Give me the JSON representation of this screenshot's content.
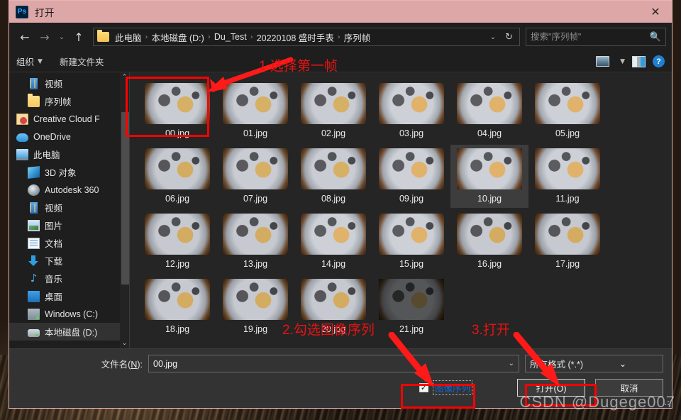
{
  "window": {
    "title": "打开",
    "app_icon": "photoshop-icon",
    "close_label": "✕",
    "titlebar_color": "#dea7a7"
  },
  "nav": {
    "back": "←",
    "forward": "→",
    "recent": "⌄",
    "up": "↑",
    "breadcrumbs": [
      "此电脑",
      "本地磁盘 (D:)",
      "Du_Test",
      "20220108 盛时手表",
      "序列帧"
    ],
    "separator": "›",
    "dropdown_caret": "⌄",
    "refresh": "↻",
    "search_placeholder": "搜索\"序列帧\"",
    "search_value": "",
    "search_icon": "search-icon"
  },
  "command_bar": {
    "organize": "组织",
    "organize_caret": "▼",
    "new_folder": "新建文件夹",
    "view_caret": "▼",
    "icons": [
      "view-mode-icon",
      "preview-pane-icon",
      "help-icon"
    ],
    "help_glyph": "?"
  },
  "sidebar": {
    "items": [
      {
        "label": "视频",
        "icon": "video-icon",
        "indent": true,
        "selected": false
      },
      {
        "label": "序列帧",
        "icon": "folder-icon",
        "indent": true,
        "selected": false
      },
      {
        "label": "Creative Cloud F",
        "icon": "creative-cloud-icon",
        "indent": false,
        "selected": false
      },
      {
        "label": "OneDrive",
        "icon": "onedrive-icon",
        "indent": false,
        "selected": false
      },
      {
        "label": "此电脑",
        "icon": "this-pc-icon",
        "indent": false,
        "selected": false
      },
      {
        "label": "3D 对象",
        "icon": "3d-objects-icon",
        "indent": true,
        "selected": false
      },
      {
        "label": "Autodesk 360",
        "icon": "autodesk-icon",
        "indent": true,
        "selected": false
      },
      {
        "label": "视频",
        "icon": "video-icon",
        "indent": true,
        "selected": false
      },
      {
        "label": "图片",
        "icon": "pictures-icon",
        "indent": true,
        "selected": false
      },
      {
        "label": "文档",
        "icon": "documents-icon",
        "indent": true,
        "selected": false
      },
      {
        "label": "下载",
        "icon": "downloads-icon",
        "indent": true,
        "selected": false
      },
      {
        "label": "音乐",
        "icon": "music-icon",
        "indent": true,
        "selected": false
      },
      {
        "label": "桌面",
        "icon": "desktop-icon",
        "indent": true,
        "selected": false
      },
      {
        "label": "Windows (C:)",
        "icon": "drive-icon",
        "indent": true,
        "selected": false
      },
      {
        "label": "本地磁盘 (D:)",
        "icon": "drive-icon",
        "indent": true,
        "selected": true
      }
    ],
    "scroll_up": "⌃",
    "scroll_down": "⌄"
  },
  "files": [
    {
      "name": "00.jpg",
      "selected": false,
      "style": "wm"
    },
    {
      "name": "01.jpg",
      "selected": false,
      "style": "wm"
    },
    {
      "name": "02.jpg",
      "selected": false,
      "style": "wm"
    },
    {
      "name": "03.jpg",
      "selected": false,
      "style": "wm v2"
    },
    {
      "name": "04.jpg",
      "selected": false,
      "style": "wm v2"
    },
    {
      "name": "05.jpg",
      "selected": false,
      "style": "wm v2"
    },
    {
      "name": "06.jpg",
      "selected": false,
      "style": "wm v3"
    },
    {
      "name": "07.jpg",
      "selected": false,
      "style": "wm"
    },
    {
      "name": "08.jpg",
      "selected": false,
      "style": "wm"
    },
    {
      "name": "09.jpg",
      "selected": false,
      "style": "wm v2"
    },
    {
      "name": "10.jpg",
      "selected": true,
      "style": "wm v2"
    },
    {
      "name": "11.jpg",
      "selected": false,
      "style": "wm v2"
    },
    {
      "name": "12.jpg",
      "selected": false,
      "style": "wm v3"
    },
    {
      "name": "13.jpg",
      "selected": false,
      "style": "wm v3"
    },
    {
      "name": "14.jpg",
      "selected": false,
      "style": "wm v2"
    },
    {
      "name": "15.jpg",
      "selected": false,
      "style": "wm v2"
    },
    {
      "name": "16.jpg",
      "selected": false,
      "style": "wm v3"
    },
    {
      "name": "17.jpg",
      "selected": false,
      "style": "wm v3"
    },
    {
      "name": "18.jpg",
      "selected": false,
      "style": "wm v3"
    },
    {
      "name": "19.jpg",
      "selected": false,
      "style": "wm v3"
    },
    {
      "name": "20.jpg",
      "selected": false,
      "style": "wm v3"
    },
    {
      "name": "21.jpg",
      "selected": false,
      "style": "wm dark"
    }
  ],
  "bottom": {
    "filename_label_pre": "文件名(",
    "filename_label_key": "N",
    "filename_label_post": "):",
    "filename_value": "00.jpg",
    "filename_caret": "⌄",
    "format_value": "所有格式 (*.*)",
    "format_caret": "⌄",
    "checkbox_label": "图像序列",
    "checkbox_checked": true,
    "checkbox_mark": "✓",
    "open_button": "打开(O)",
    "cancel_button": "取消"
  },
  "annotations": {
    "step1": "1.选择第一帧",
    "step2": "2.勾选图像序列",
    "step3": "3.打开",
    "color": "#e81313",
    "watermark": "CSDN @Dugege007"
  }
}
